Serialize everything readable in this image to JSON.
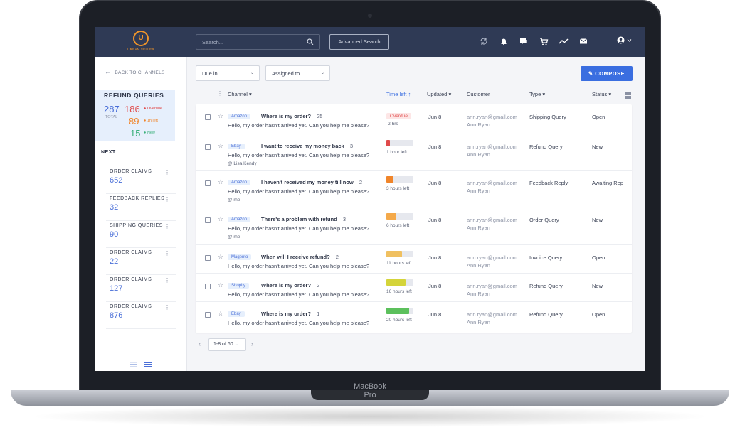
{
  "device": {
    "brand": "MacBook Pro"
  },
  "app": {
    "logo_letter": "U",
    "logo_text": "URBAN SELLER"
  },
  "topbar": {
    "search_placeholder": "Search...",
    "advanced_search": "Advanced Search",
    "icons": [
      "sync-icon",
      "bell-icon",
      "chat-icon",
      "cart-icon",
      "trend-icon",
      "mail-icon"
    ]
  },
  "sidebar": {
    "back": "BACK TO CHANNELS",
    "section_title": "REFUND QUERIES",
    "total": "287",
    "total_label": "TOTAL",
    "overdue": "186",
    "overdue_label": "Overdue",
    "onehour": "89",
    "onehour_label": "1h left",
    "new": "15",
    "new_label": "New",
    "next_label": "NEXT",
    "items": [
      {
        "label": "ORDER CLAIMS",
        "count": "652"
      },
      {
        "label": "FEEDBACK REPLIES",
        "count": "32"
      },
      {
        "label": "SHIPPING QUERIES",
        "count": "90"
      },
      {
        "label": "ORDER CLAIMS",
        "count": "22"
      },
      {
        "label": "ORDER CLAIMS",
        "count": "127"
      },
      {
        "label": "ORDER CLAIMS",
        "count": "876"
      }
    ]
  },
  "filters": {
    "due_in": "Due in",
    "assigned_to": "Assigned to"
  },
  "compose": "COMPOSE",
  "columns": {
    "channel": "Channel",
    "time_left": "Time left",
    "updated": "Updated",
    "customer": "Customer",
    "type": "Type",
    "status": "Status"
  },
  "rows": [
    {
      "channel": "Amazon",
      "subject": "Where is my order?",
      "count": "25",
      "preview": "Hello, my order hasn't arrived yet. Can you help me please?",
      "assignee": "",
      "time_label": "-2 hrs",
      "overdue": "Overdue",
      "progress": 0,
      "color": "#e04a4a",
      "updated": "Jun 8",
      "email": "ann.ryan@gmail.com",
      "name": "Ann Ryan",
      "type": "Shipping Query",
      "status": "Open"
    },
    {
      "channel": "Ebay",
      "subject": "I want to receive my money back",
      "count": "3",
      "preview": "Hello, my order hasn't arrived yet. Can you help me please?",
      "assignee": "@ Lisa Kendy",
      "time_label": "1 hour left",
      "overdue": "",
      "progress": 0.12,
      "color": "#e04a4a",
      "updated": "Jun 8",
      "email": "ann.ryan@gmail.com",
      "name": "Ann Ryan",
      "type": "Refund Query",
      "status": "New"
    },
    {
      "channel": "Amazon",
      "subject": "I haven't received my money till now",
      "count": "2",
      "preview": "Hello, my order hasn't arrived yet. Can you help me please?",
      "assignee": "@ me",
      "time_label": "3 hours left",
      "overdue": "",
      "progress": 0.25,
      "color": "#f0852a",
      "updated": "Jun 8",
      "email": "ann.ryan@gmail.com",
      "name": "Ann Ryan",
      "type": "Feedback Reply",
      "status": "Awaiting Rep"
    },
    {
      "channel": "Amazon",
      "subject": "There's a problem with refund",
      "count": "3",
      "preview": "Hello, my order hasn't arrived yet. Can you help me please?",
      "assignee": "@ me",
      "time_label": "6 hours left",
      "overdue": "",
      "progress": 0.38,
      "color": "#f4a94a",
      "updated": "Jun 8",
      "email": "ann.ryan@gmail.com",
      "name": "Ann Ryan",
      "type": "Order Query",
      "status": "New"
    },
    {
      "channel": "Magento",
      "subject": "When will I receive refund?",
      "count": "2",
      "preview": "Hello, my order hasn't arrived yet. Can you help me please?",
      "assignee": "",
      "time_label": "11 hours left",
      "overdue": "",
      "progress": 0.58,
      "color": "#f0c060",
      "updated": "Jun 8",
      "email": "ann.ryan@gmail.com",
      "name": "Ann Ryan",
      "type": "Invoice Query",
      "status": "Open"
    },
    {
      "channel": "Shopify",
      "subject": "Where is my order?",
      "count": "2",
      "preview": "Hello, my order hasn't arrived yet. Can you help me please?",
      "assignee": "",
      "time_label": "16 hours left",
      "overdue": "",
      "progress": 0.72,
      "color": "#d4d43a",
      "updated": "Jun 8",
      "email": "ann.ryan@gmail.com",
      "name": "Ann Ryan",
      "type": "Refund Query",
      "status": "New"
    },
    {
      "channel": "Ebay",
      "subject": "Where is my order?",
      "count": "1",
      "preview": "Hello, my order hasn't arrived yet. Can you help me please?",
      "assignee": "",
      "time_label": "20 hours left",
      "overdue": "",
      "progress": 0.85,
      "color": "#5cc05c",
      "updated": "Jun 8",
      "email": "ann.ryan@gmail.com",
      "name": "Ann Ryan",
      "type": "Refund Query",
      "status": "Open"
    }
  ],
  "pagination": {
    "label": "1-8 of 60"
  }
}
